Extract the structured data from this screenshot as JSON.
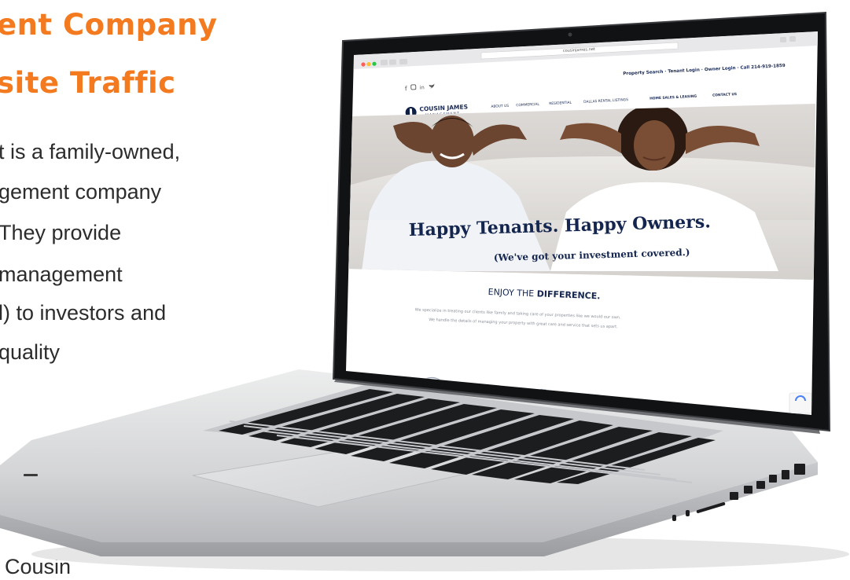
{
  "promo": {
    "headline_line1": "ent Company",
    "headline_line2": "site Traffic",
    "body_lines": [
      "t is a family-owned,",
      "gement company",
      "They provide",
      "management",
      "l) to investors and",
      "quality",
      "Cousin"
    ]
  },
  "screen": {
    "browser": {
      "url": "cousinjames.net"
    },
    "site": {
      "social_icons": [
        "facebook-icon",
        "instagram-icon",
        "linkedin-icon",
        "twitter-icon"
      ],
      "top_links": "Property Search · Tenant Login · Owner Login · Call 214-919-1859",
      "logo_name": "COUSIN JAMES",
      "logo_sub": "MANAGEMENT",
      "nav": [
        "ABOUT US",
        "COMMERCIAL",
        "RESIDENTIAL",
        "DALLAS RENTAL LISTINGS",
        "HOME SALES & LEASING",
        "CONTACT US"
      ],
      "hero_title": "Happy Tenants. Happy Owners.",
      "hero_subtitle": "(We've got your investment covered.)",
      "section_title_prefix": "ENJOY THE ",
      "section_title_bold": "DIFFERENCE.",
      "section_text_1": "We specialize in treating our clients like family and taking care of your properties like we would our own.",
      "section_text_2": "We handle the details of managing your property with great care and service that sets us apart."
    }
  },
  "colors": {
    "accent": "#f47a20",
    "body_text": "#2c2c2c",
    "laptop_silver": "#d9dadc",
    "bezel": "#111214"
  }
}
